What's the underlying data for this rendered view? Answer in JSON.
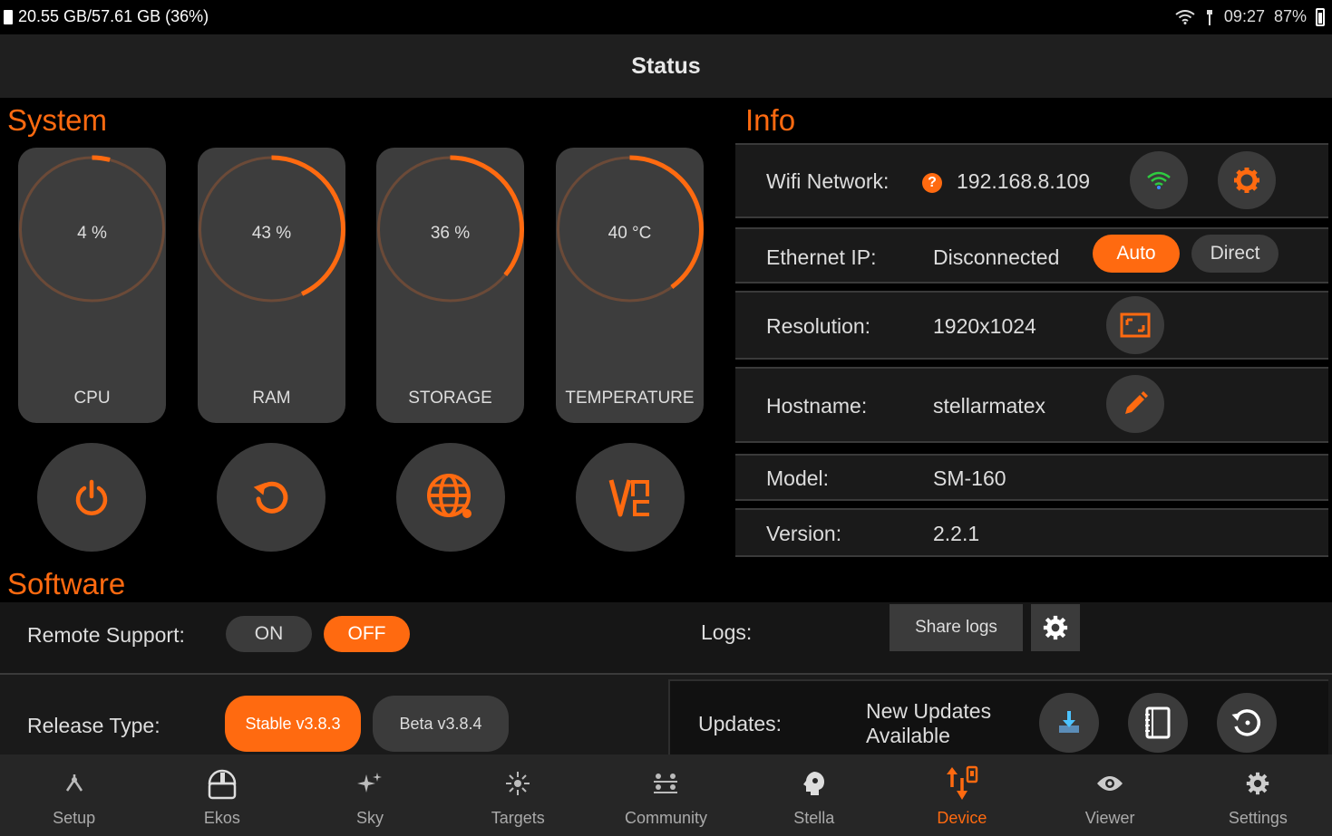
{
  "statusbar": {
    "storage": "20.55 GB/57.61 GB (36%)",
    "time": "09:27",
    "battery": "87%"
  },
  "title": "Status",
  "system": {
    "title": "System",
    "gauges": [
      {
        "value_text": "4 %",
        "label": "CPU",
        "fraction": 0.04
      },
      {
        "value_text": "43 %",
        "label": "RAM",
        "fraction": 0.43
      },
      {
        "value_text": "36 %",
        "label": "STORAGE",
        "fraction": 0.36
      },
      {
        "value_text": "40 °C",
        "label": "TEMPERATURE",
        "fraction": 0.4
      }
    ],
    "actions": [
      "power-icon",
      "restart-icon",
      "globe-icon",
      "vnc-icon"
    ]
  },
  "info": {
    "title": "Info",
    "wifi_label": "Wifi Network:",
    "wifi_value": "192.168.8.109",
    "ethernet_label": "Ethernet IP:",
    "ethernet_value": "Disconnected",
    "auto_label": "Auto",
    "direct_label": "Direct",
    "resolution_label": "Resolution:",
    "resolution_value": "1920x1024",
    "hostname_label": "Hostname:",
    "hostname_value": "stellarmatex",
    "model_label": "Model:",
    "model_value": "SM-160",
    "version_label": "Version:",
    "version_value": "2.2.1"
  },
  "software": {
    "title": "Software",
    "remote_label": "Remote Support:",
    "on_label": "ON",
    "off_label": "OFF",
    "logs_label": "Logs:",
    "share_logs_label": "Share logs",
    "release_label": "Release Type:",
    "stable_label": "Stable v3.8.3",
    "beta_label": "Beta v3.8.4",
    "updates_label": "Updates:",
    "updates_status_line1": "New Updates",
    "updates_status_line2": "Available"
  },
  "nav": [
    {
      "label": "Setup",
      "icon": "setup-icon"
    },
    {
      "label": "Ekos",
      "icon": "ekos-icon"
    },
    {
      "label": "Sky",
      "icon": "sky-icon"
    },
    {
      "label": "Targets",
      "icon": "targets-icon"
    },
    {
      "label": "Community",
      "icon": "community-icon"
    },
    {
      "label": "Stella",
      "icon": "stella-icon"
    },
    {
      "label": "Device",
      "icon": "device-icon"
    },
    {
      "label": "Viewer",
      "icon": "viewer-icon"
    },
    {
      "label": "Settings",
      "icon": "settings-icon"
    }
  ],
  "colors": {
    "accent": "#ff6a10",
    "card": "#3d3d3d",
    "ring": "#6b4a38"
  }
}
